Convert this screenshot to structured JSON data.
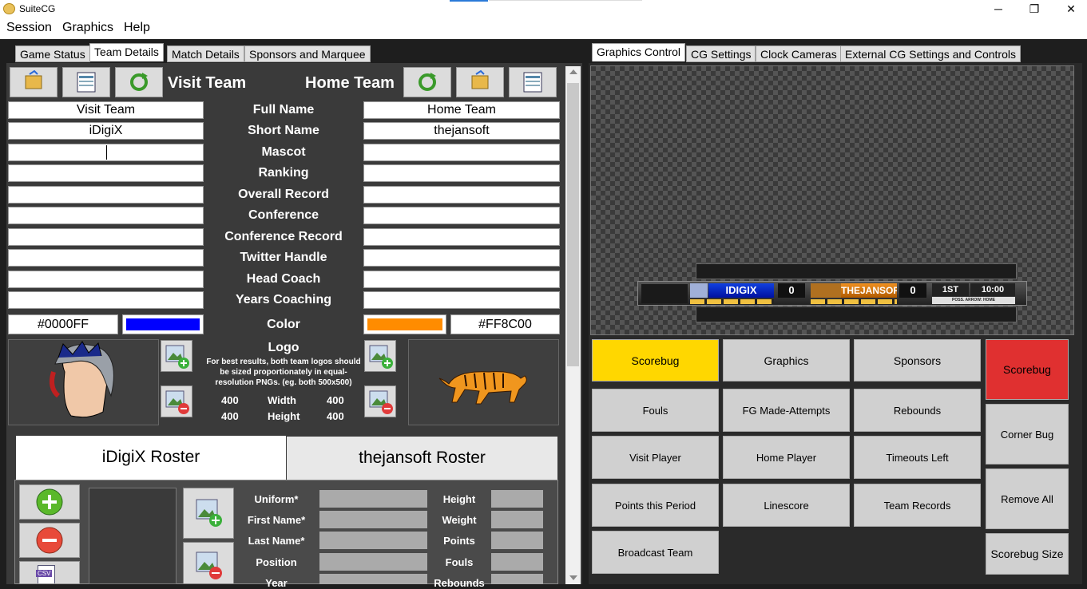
{
  "window": {
    "title": "SuiteCG",
    "minimize": "─",
    "restore": "❐",
    "close": "✕"
  },
  "menu": [
    "Session",
    "Graphics",
    "Help"
  ],
  "left_tabs": [
    "Game Status",
    "Team Details",
    "Match Details",
    "Sponsors and Marquee"
  ],
  "right_tabs": [
    "Graphics Control",
    "CG Settings",
    "Clock Cameras",
    "External CG Settings and Controls"
  ],
  "team": {
    "visit_title": "Visit Team",
    "home_title": "Home Team",
    "labels": [
      "Full Name",
      "Short Name",
      "Mascot",
      "Ranking",
      "Overall Record",
      "Conference",
      "Conference Record",
      "Twitter Handle",
      "Head Coach",
      "Years Coaching"
    ],
    "visit_values": [
      "Visit Team",
      "iDigiX",
      "",
      "",
      "",
      "",
      "",
      "",
      "",
      ""
    ],
    "home_values": [
      "Home Team",
      "thejansoft",
      "",
      "",
      "",
      "",
      "",
      "",
      "",
      ""
    ],
    "color_label": "Color",
    "visit_color": "#0000FF",
    "home_color": "#FF8C00",
    "logo_label": "Logo",
    "logo_note": "For best results, both team logos should be sized proportionately in equal-resolution PNGs. (eg. both 500x500)",
    "width_label": "Width",
    "height_label": "Height",
    "visit_width": "400",
    "visit_height": "400",
    "home_width": "400",
    "home_height": "400"
  },
  "roster": {
    "visit_tab": "iDigiX Roster",
    "home_tab": "thejansoft Roster",
    "left_labels": [
      "Uniform*",
      "First Name*",
      "Last Name*",
      "Position",
      "Year"
    ],
    "right_labels": [
      "Height",
      "Weight",
      "Points",
      "Fouls",
      "Rebounds"
    ],
    "csv_label": "CSV"
  },
  "scorebug": {
    "visit": "IDIGIX",
    "visit_score": "0",
    "home": "THEJANSOFT",
    "home_score": "0",
    "period": "1ST",
    "clock": "10:00",
    "poss": "POSS. ARROW: HOME"
  },
  "graphics_buttons": {
    "row1": [
      "Scorebug",
      "Graphics",
      "Sponsors"
    ],
    "grid": [
      [
        "Fouls",
        "FG Made-Attempts",
        "Rebounds"
      ],
      [
        "Visit Player",
        "Home Player",
        "Timeouts Left"
      ],
      [
        "Points this Period",
        "Linescore",
        "Team Records"
      ],
      [
        "Broadcast Team"
      ]
    ],
    "side": [
      "Scorebug",
      "Corner Bug",
      "Remove All",
      "Scorebug Size"
    ]
  },
  "colors": {
    "scorebug_active": "#FFD700",
    "side_active": "#E03030"
  }
}
